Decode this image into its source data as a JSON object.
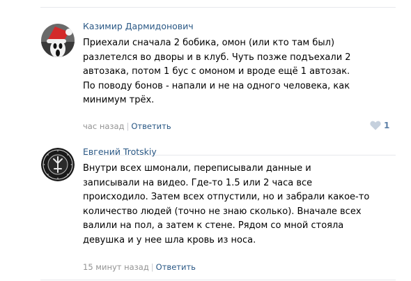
{
  "comments": [
    {
      "author": "Казимир Дармидонович",
      "text": "Приехали сначала 2 бобика, омон (или кто там был)\nразлетелся во дворы и в клуб. Чуть позже подъехали 2\nавтозака, потом 1 бус с омоном и вроде ещё 1 автозак.\nПо поводу бонов - напали и не на одного человека, как\nминимум трёх.",
      "time": "час назад",
      "reply_label": "Ответить",
      "likes": "1"
    },
    {
      "author": "Евгений Trotskiy",
      "text": "Внутри всех шмонали, переписывали данные и\nзаписывали на видео. Где-то 1.5 или 2 часа все\nпроисходило. Затем всех отпустили, но и забрали какое-то\nколичество людей (точно не знаю сколько). Вначале всех\nвалили на пол, а затем к стене. Рядом со мной стояла\nдевушка и у нее шла кровь из носа.",
      "time": "15 минут назад",
      "reply_label": "Ответить"
    }
  ],
  "colors": {
    "author": "#2a5885",
    "meta": "#939393",
    "like": "#5b7fa6",
    "divider": "#e7e8ec"
  },
  "icons": {
    "like": "heart-icon"
  }
}
